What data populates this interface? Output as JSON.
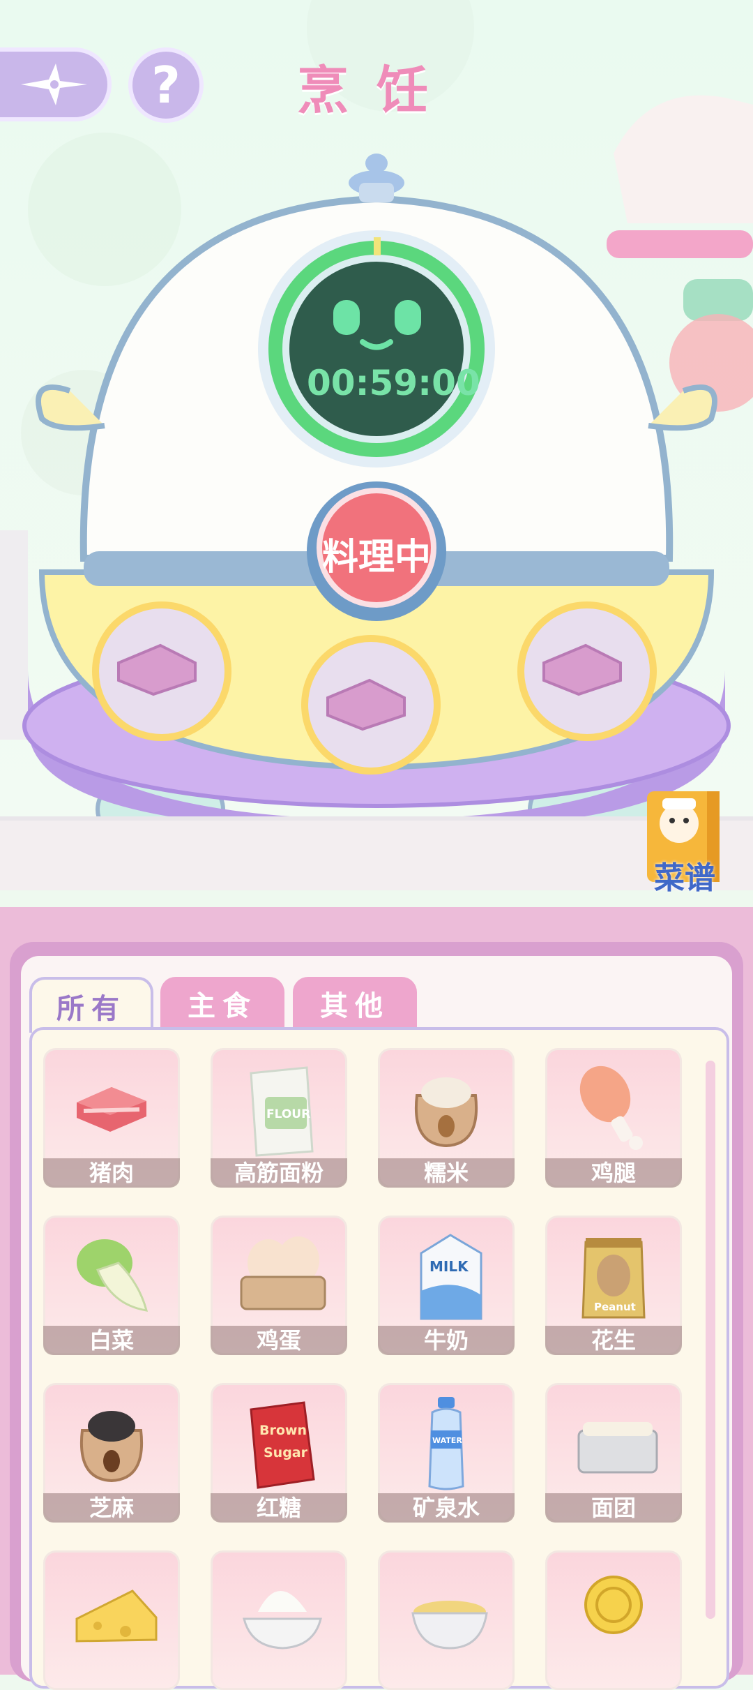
{
  "header": {
    "title": "烹饪",
    "back_icon": "compass-star-icon",
    "help_label": "?"
  },
  "cooker": {
    "timer": "00:59:00",
    "status_label": "料理中",
    "slots": [
      "pork",
      "pork",
      "pork"
    ]
  },
  "recipe_book": {
    "label": "菜谱"
  },
  "tabs": [
    {
      "label": "所有",
      "active": true
    },
    {
      "label": "主食",
      "active": false
    },
    {
      "label": "其他",
      "active": false
    }
  ],
  "ingredients": [
    {
      "label": "猪肉",
      "icon": "pork-icon"
    },
    {
      "label": "高筋面粉",
      "icon": "flour-icon"
    },
    {
      "label": "糯米",
      "icon": "rice-sack-icon"
    },
    {
      "label": "鸡腿",
      "icon": "drumstick-icon"
    },
    {
      "label": "白菜",
      "icon": "cabbage-icon"
    },
    {
      "label": "鸡蛋",
      "icon": "eggs-icon"
    },
    {
      "label": "牛奶",
      "icon": "milk-icon"
    },
    {
      "label": "花生",
      "icon": "peanut-bag-icon"
    },
    {
      "label": "芝麻",
      "icon": "sesame-sack-icon"
    },
    {
      "label": "红糖",
      "icon": "brown-sugar-icon"
    },
    {
      "label": "矿泉水",
      "icon": "water-bottle-icon"
    },
    {
      "label": "面团",
      "icon": "dough-icon"
    },
    {
      "label": "",
      "icon": "cheese-icon"
    },
    {
      "label": "",
      "icon": "cream-icon"
    },
    {
      "label": "",
      "icon": "custard-icon"
    },
    {
      "label": "",
      "icon": "coin-icon"
    }
  ],
  "item_text": {
    "flour": "FLOUR",
    "milk": "MILK",
    "peanut": "Peanut",
    "brown": "Brown",
    "sugar": "Sugar",
    "water": "WATER"
  }
}
